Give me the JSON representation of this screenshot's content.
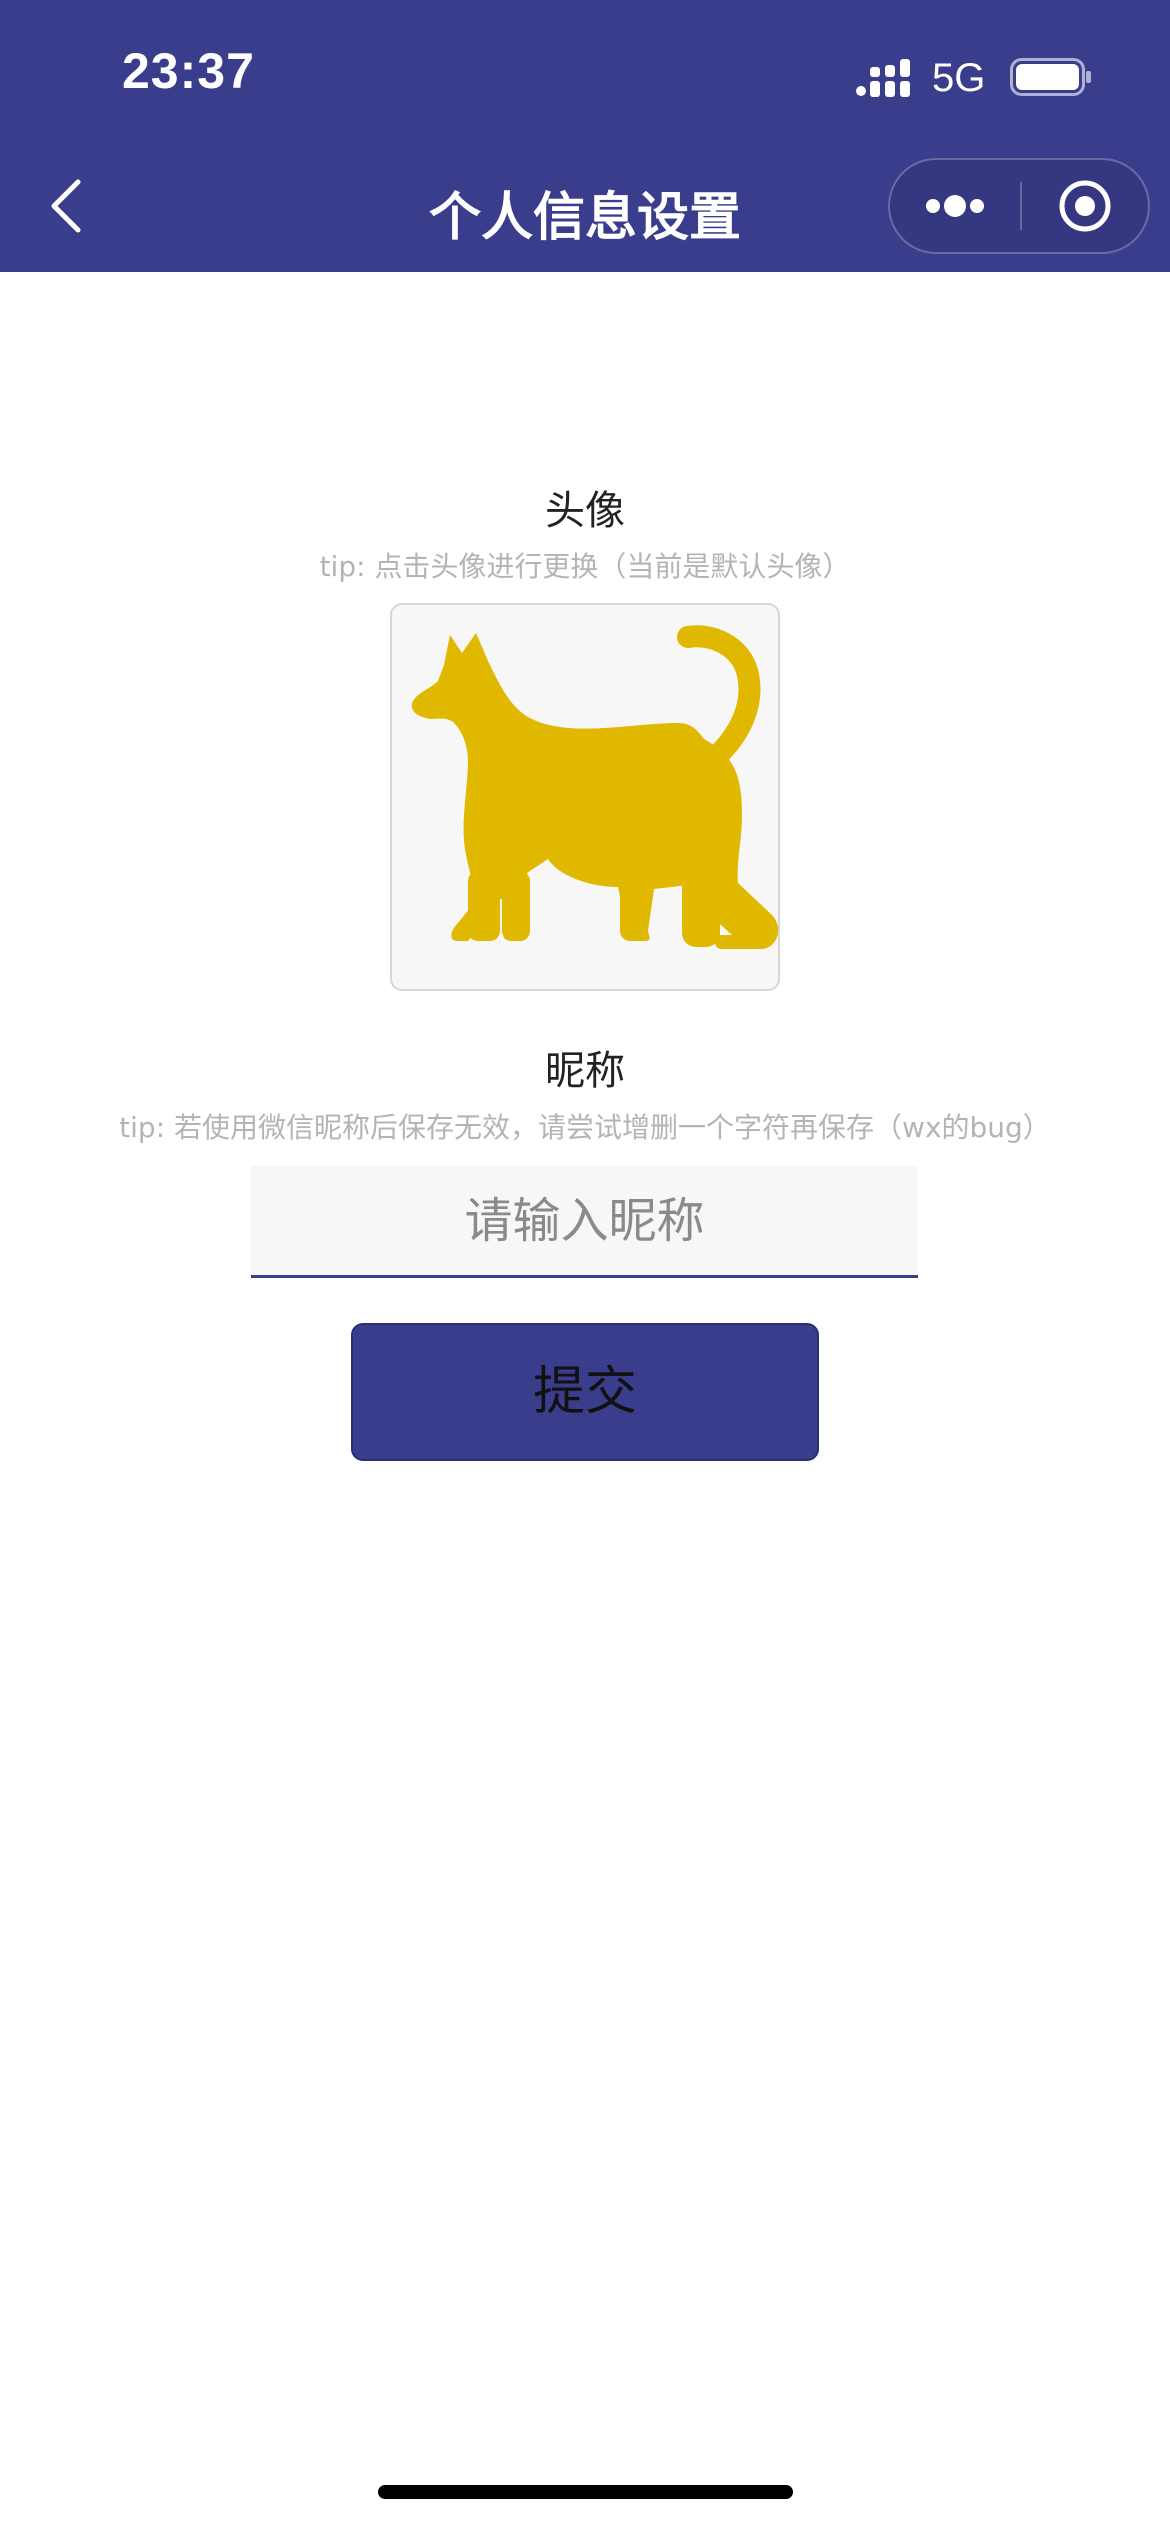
{
  "status_bar": {
    "time": "23:37",
    "network": "5G"
  },
  "nav": {
    "title": "个人信息设置"
  },
  "avatar_section": {
    "label": "头像",
    "tip": "tip: 点击头像进行更换（当前是默认头像）",
    "avatar_icon": "cat-silhouette",
    "avatar_color": "#e0b800"
  },
  "nickname_section": {
    "label": "昵称",
    "tip": "tip: 若使用微信昵称后保存无效，请尝试增删一个字符再保存（wx的bug）",
    "input_value": "",
    "input_placeholder": "请输入昵称"
  },
  "submit": {
    "label": "提交"
  },
  "colors": {
    "primary": "#3a3d8c",
    "avatar_bg": "#f7f7f7",
    "tip_text": "#b4b4b4"
  }
}
